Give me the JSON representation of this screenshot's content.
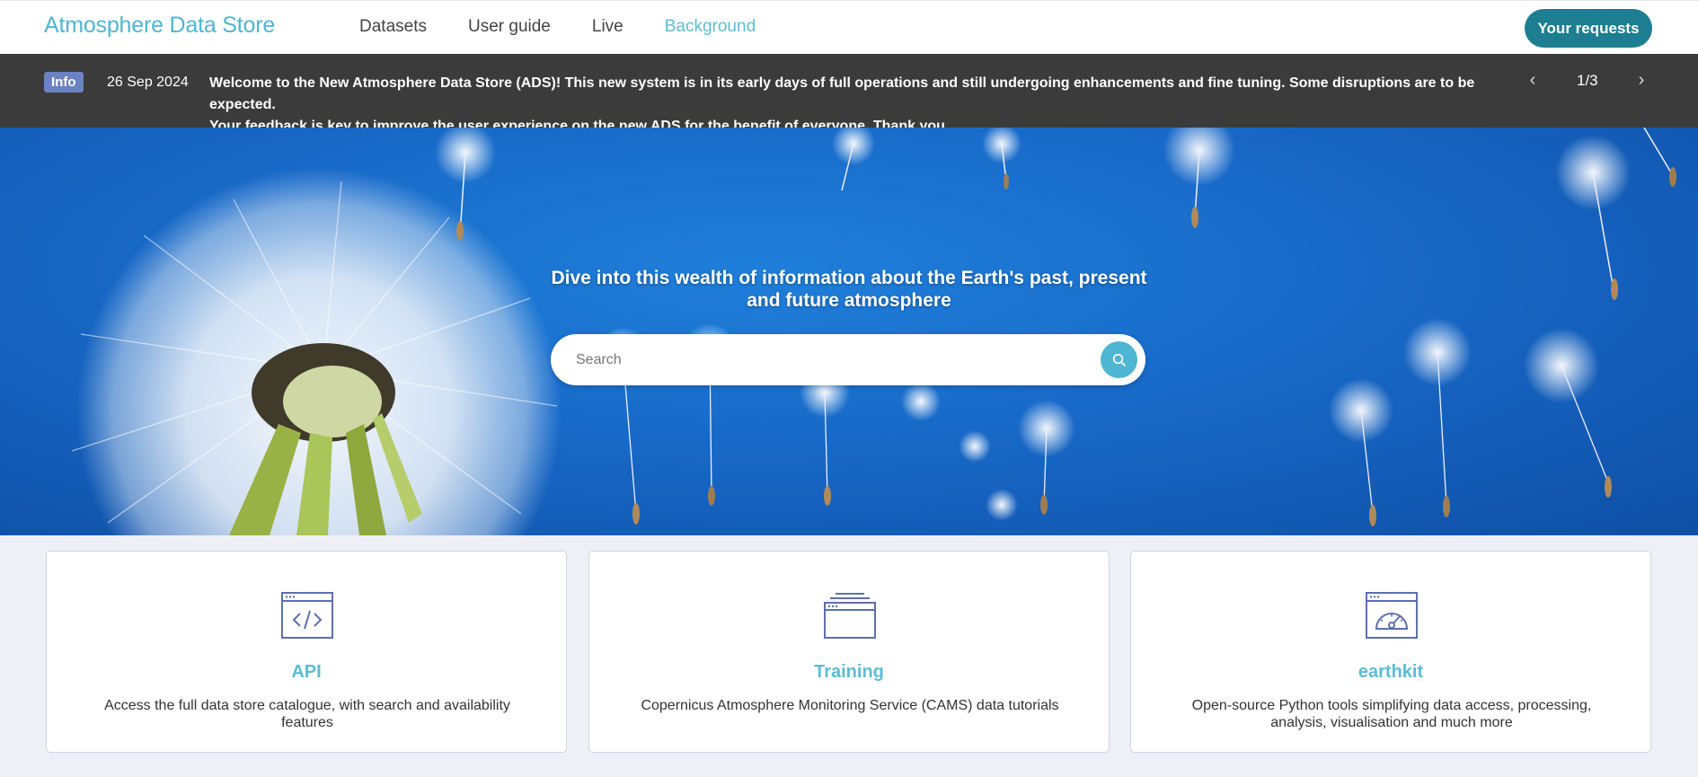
{
  "header": {
    "brand": "Atmosphere Data Store",
    "nav": [
      {
        "label": "Datasets"
      },
      {
        "label": "User guide"
      },
      {
        "label": "Live"
      },
      {
        "label": "Background"
      }
    ],
    "active_nav": "Background",
    "requests_button": "Your requests"
  },
  "banner": {
    "badge": "Info",
    "date": "26 Sep 2024",
    "line1": "Welcome to the New Atmosphere Data Store (ADS)! This new system is in its early days of full operations and still undergoing enhancements and fine tuning. Some disruptions are to be expected.",
    "line2_prefix": "Your ",
    "line2_link": "feedback",
    "line2_suffix": " is key to improve the user experience on the new ADS for the benefit of everyone. Thank you.",
    "prev_icon": "chevron-left-icon",
    "next_icon": "chevron-right-icon",
    "page": "1/3"
  },
  "hero": {
    "title": "Dive into this wealth of information about the Earth's past, present and future atmosphere",
    "search_placeholder": "Search",
    "search_icon": "search-icon"
  },
  "cards": [
    {
      "icon": "code-window-icon",
      "title": "API",
      "description": "Access the full data store catalogue, with search and availability features"
    },
    {
      "icon": "stacked-windows-icon",
      "title": "Training",
      "description": "Copernicus Atmosphere Monitoring Service (CAMS) data tutorials"
    },
    {
      "icon": "gauge-window-icon",
      "title": "earthkit",
      "description": "Open-source Python tools simplifying data access, processing, analysis, visualisation and much more"
    }
  ],
  "colors": {
    "accent": "#4fb6d3",
    "button": "#1c7e90",
    "banner_bg": "#3b3b3b",
    "badge": "#6b82c3",
    "icon": "#5d6fae"
  }
}
